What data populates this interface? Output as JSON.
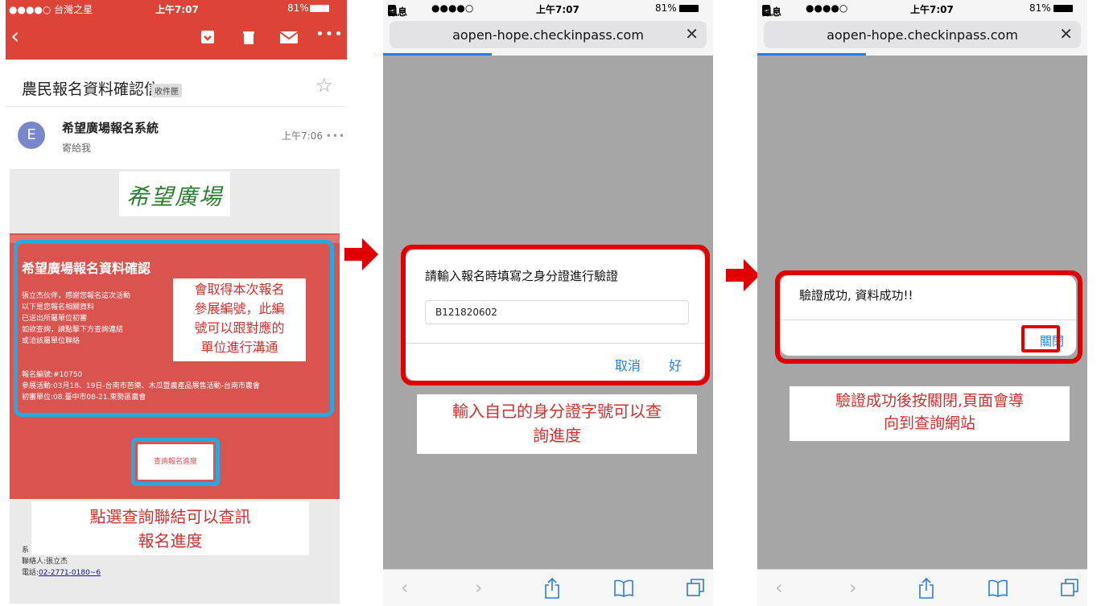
{
  "phone1": {
    "status": {
      "carrier": "●●●●○ 台灣之星",
      "time": "上午7:07",
      "battery": "81%"
    },
    "subject": "農民報名資料確認信",
    "inbox_tag": "收件匣",
    "sender_initial": "E",
    "sender": "希望廣場報名系統",
    "to_me": "寄給我",
    "time": "上午7:06",
    "logo_text": "希望廣場",
    "card_title": "希望廣場報名資料確認",
    "card_lines": [
      "張立杰伙伴，感謝您報名這次活動",
      "以下是您報名相關資料",
      "已送出所屬單位初審",
      "如欲查詢，請點擊下方查詢連結",
      "或洽該屬單位聯絡"
    ],
    "reg_no": "報名編號:#10750",
    "event_line": "參展活動:03月18、19日-台南市芭樂、木瓜暨農產品展售活動-台南市農會",
    "review_line": "初審單位:08.臺中市08-21.東勢區農會",
    "note_top": "會取得本次報名參展編號，此編號可以跟對應的單位進行溝通",
    "note_top_lines": [
      "會取得本次報名",
      "參展編號，此編",
      "號可以跟對應的",
      "單位進行溝通"
    ],
    "query_button": "查詢報名進度",
    "note_bottom_lines": [
      "點選查詢聯結可以查訊",
      "報名進度"
    ],
    "footer_sys": "系",
    "footer_contact": "聯絡人:張立杰",
    "footer_tel_label": "電話:",
    "footer_tel": "02-2771-0180~6"
  },
  "phone2": {
    "status": {
      "back": "訊息",
      "signal": "●●●●○",
      "time": "上午7:07",
      "battery": "81%"
    },
    "url": "aopen-hope.checkinpass.com",
    "dialog_title": "請輸入報名時填寫之身分證進行驗證",
    "input_value": "B121820602",
    "cancel": "取消",
    "ok": "好",
    "note_lines": [
      "輸入自己的身分證字號可以查",
      "詢進度"
    ]
  },
  "phone3": {
    "status": {
      "back": "訊息",
      "signal": "●●●●○",
      "time": "上午7:07",
      "battery": "81%"
    },
    "url": "aopen-hope.checkinpass.com",
    "dialog_title": "驗證成功, 資料成功!!",
    "close": "關閉",
    "note_lines": [
      "驗證成功後按關閉,頁面會導",
      "向到查詢網站"
    ]
  },
  "colors": {
    "gmail_red": "#db4437",
    "card_red": "#d9534f",
    "highlight_blue": "#29a8e0",
    "frame_red": "#e00000",
    "ios_blue": "#2a7de1"
  },
  "icons": [
    "back-chevron-icon",
    "archive-icon",
    "trash-icon",
    "mail-icon",
    "more-icon",
    "star-icon",
    "close-icon",
    "share-icon",
    "bookmarks-icon",
    "tabs-icon",
    "right-arrow-icon"
  ]
}
